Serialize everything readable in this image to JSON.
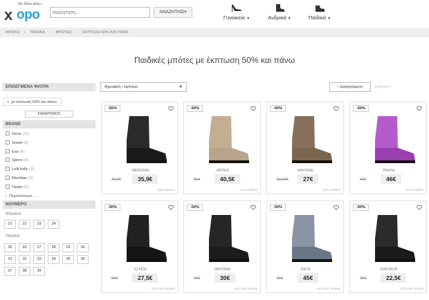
{
  "header": {
    "logo_tagline": "δεν θέλω κάτω...",
    "logo_x": "x",
    "logo_text": "opo",
    "search_placeholder": "αναζήτηση...",
    "search_button": "ΑΝΑΖΗΤΗΣΗ",
    "nav": [
      {
        "label": "Γυναικεία",
        "icon": "high-heel-icon"
      },
      {
        "label": "Ανδρικά",
        "icon": "boot-icon"
      },
      {
        "label": "Παιδικά",
        "icon": "kids-shoe-icon"
      }
    ]
  },
  "breadcrumb": [
    "ΑΡΧΙΚΗ",
    "ΠΑΙΔΙΚΑ",
    "ΜΠΟΤΕΣ",
    "ΕΚΠΤΩΣΗ 50% ΚΑΙ ΠΑΝΩ"
  ],
  "page_title": "Παιδικές μπότες με έκπτωση 50% και πάνω",
  "filters": {
    "selected_title": "ΕΠΙΛΕΓΜΕΝΑ ΦΙΛΤΡΑ",
    "selected_chip": "με έκπτωση 50% και πάνω",
    "clear_button": "ΚΑΘΑΡΙΣΜΟΣ",
    "brand_title": "BRAND",
    "brands": [
      {
        "name": "Geox",
        "count": "(11)"
      },
      {
        "name": "Smart",
        "count": "(6)"
      },
      {
        "name": "Exe",
        "count": "(4)"
      },
      {
        "name": "Sprox",
        "count": "(4)"
      },
      {
        "name": "Lelli kelly",
        "count": "(3)"
      },
      {
        "name": "Meridian",
        "count": "(2)"
      },
      {
        "name": "Opam",
        "count": "(2)"
      }
    ],
    "more": "Περισσότερα ...",
    "size_title": "ΝΟΥΜΕΡΟ",
    "baby_label": "ΒΡΕΦΙΚΑ:",
    "baby_sizes": [
      "21",
      "22",
      "23",
      "24"
    ],
    "kids_label": "ΠΑΙΔΙΚΑ:",
    "kids_sizes": [
      "25",
      "26",
      "27",
      "28",
      "29",
      "30",
      "31",
      "32",
      "33",
      "34",
      "35",
      "36",
      "37",
      "38",
      "39"
    ]
  },
  "toolbar": {
    "sort_value": "δημοφιλή › λιγότερο",
    "prev": "‹ προηγούμενη",
    "next": "επόμενη ›"
  },
  "products": [
    {
      "discount": "-55%",
      "brand": "MERIDIAN",
      "old_price": "79,9€",
      "price": "35,9€",
      "store": "από myshoe",
      "color": "#1a1a1a",
      "shaft": "#2a2a2a"
    },
    {
      "discount": "-50%",
      "brand": "ARTIES",
      "old_price": "81€",
      "price": "40,5€",
      "store": "από zerafino",
      "color": "#b8a48a",
      "shaft": "#c4ae92"
    },
    {
      "discount": "-50%",
      "brand": "MAYORAL",
      "old_price": "53,99€",
      "price": "27€",
      "store": "από zerafino",
      "color": "#7a6650",
      "shaft": "#86705a"
    },
    {
      "discount": "-50%",
      "brand": "PANDA",
      "old_price": "92€",
      "price": "46€",
      "store": "από zerafino",
      "color": "#9a3fb0",
      "shaft": "#b45ccc"
    },
    {
      "discount": "-50%",
      "brand": "IQ KIDS",
      "old_price": "55€",
      "price": "27,5€",
      "store": "από click clothes",
      "color": "#151515",
      "shaft": "#222"
    },
    {
      "discount": "-50%",
      "brand": "MAYORAL",
      "old_price": "60€",
      "price": "30€",
      "store": "από click clothes",
      "color": "#1c1c1c",
      "shaft": "#262626"
    },
    {
      "discount": "-50%",
      "brand": "GEOX",
      "old_price": "90€",
      "price": "45€",
      "store": "από click clothes",
      "color": "#6a7585",
      "shaft": "#8a94a2"
    },
    {
      "discount": "-50%",
      "brand": "GARVALIN",
      "old_price": "45€",
      "price": "22,5€",
      "store": "από click clothes",
      "color": "#1a1a1a",
      "shaft": "#2b2b2b"
    }
  ]
}
